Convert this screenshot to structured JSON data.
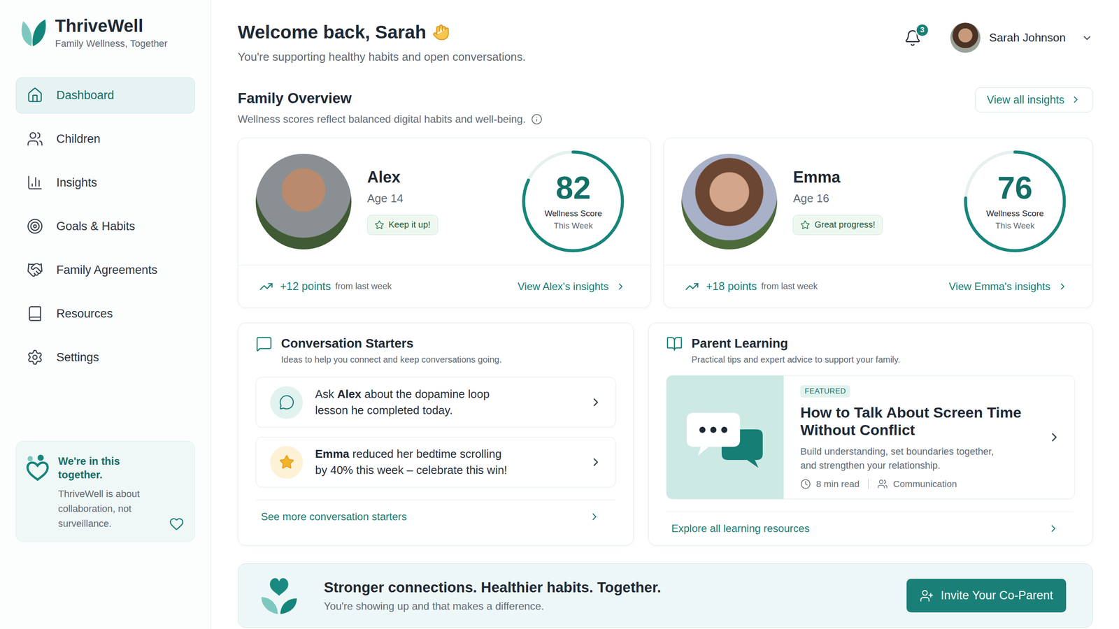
{
  "app": {
    "name": "ThriveWell",
    "tagline": "Family Wellness, Together"
  },
  "sidebar": {
    "items": [
      {
        "label": "Dashboard",
        "selected": true
      },
      {
        "label": "Children",
        "selected": false
      },
      {
        "label": "Insights",
        "selected": false
      },
      {
        "label": "Goals & Habits",
        "selected": false
      },
      {
        "label": "Family Agreements",
        "selected": false
      },
      {
        "label": "Resources",
        "selected": false
      },
      {
        "label": "Settings",
        "selected": false
      }
    ],
    "note": {
      "title": "We're in this together.",
      "lines": [
        "ThriveWell is about",
        "collaboration, not",
        "surveillance."
      ]
    }
  },
  "header": {
    "greeting": "Welcome back, Sarah",
    "subtitle": "You're supporting healthy habits and open conversations.",
    "notifications": "3",
    "user": "Sarah Johnson"
  },
  "overview": {
    "title": "Family Overview",
    "subtitle": "Wellness scores reflect balanced digital habits and well-being.",
    "view_all": "View all insights"
  },
  "children": [
    {
      "name": "Alex",
      "age": "Age 14",
      "badge": "Keep it up!",
      "score": "82",
      "level": 0.82,
      "score_label": "Wellness Score",
      "score_period": "This Week",
      "change": "+12 points",
      "change_note": "from last week",
      "link": "View Alex's insights"
    },
    {
      "name": "Emma",
      "age": "Age 16",
      "badge": "Great progress!",
      "score": "76",
      "level": 0.76,
      "score_label": "Wellness Score",
      "score_period": "This Week",
      "change": "+18 points",
      "change_note": "from last week",
      "link": "View Emma's insights"
    }
  ],
  "conversation": {
    "title": "Conversation Starters",
    "subtitle": "Ideas to help you connect and keep conversations going.",
    "items": [
      {
        "kind": "chat",
        "lines": [
          [
            {
              "text": "Ask ",
              "bold": false
            },
            {
              "text": "Alex",
              "bold": true
            },
            {
              "text": " about the dopamine loop",
              "bold": false
            }
          ],
          [
            {
              "text": "lesson he completed today.",
              "bold": false
            }
          ]
        ]
      },
      {
        "kind": "celebrate",
        "lines": [
          [
            {
              "text": "Emma",
              "bold": true
            },
            {
              "text": " reduced her bedtime scrolling",
              "bold": false
            }
          ],
          [
            {
              "text": "by 40% this week – celebrate this win!",
              "bold": false
            }
          ]
        ]
      }
    ],
    "more": "See more conversation starters"
  },
  "learning": {
    "title": "Parent Learning",
    "subtitle": "Practical tips and expert advice to support your family.",
    "featured": {
      "tag": "FEATURED",
      "title_lines": [
        "How to Talk About Screen Time",
        "Without Conflict"
      ],
      "description_lines": [
        "Build understanding, set boundaries together,",
        "and strengthen your relationship."
      ],
      "read_time": "8 min read",
      "category": "Communication"
    },
    "more": "Explore all learning resources"
  },
  "banner": {
    "title": "Stronger connections. Healthier habits. Together.",
    "subtitle": "You're showing up and that makes a difference.",
    "button": "Invite Your Co-Parent"
  }
}
